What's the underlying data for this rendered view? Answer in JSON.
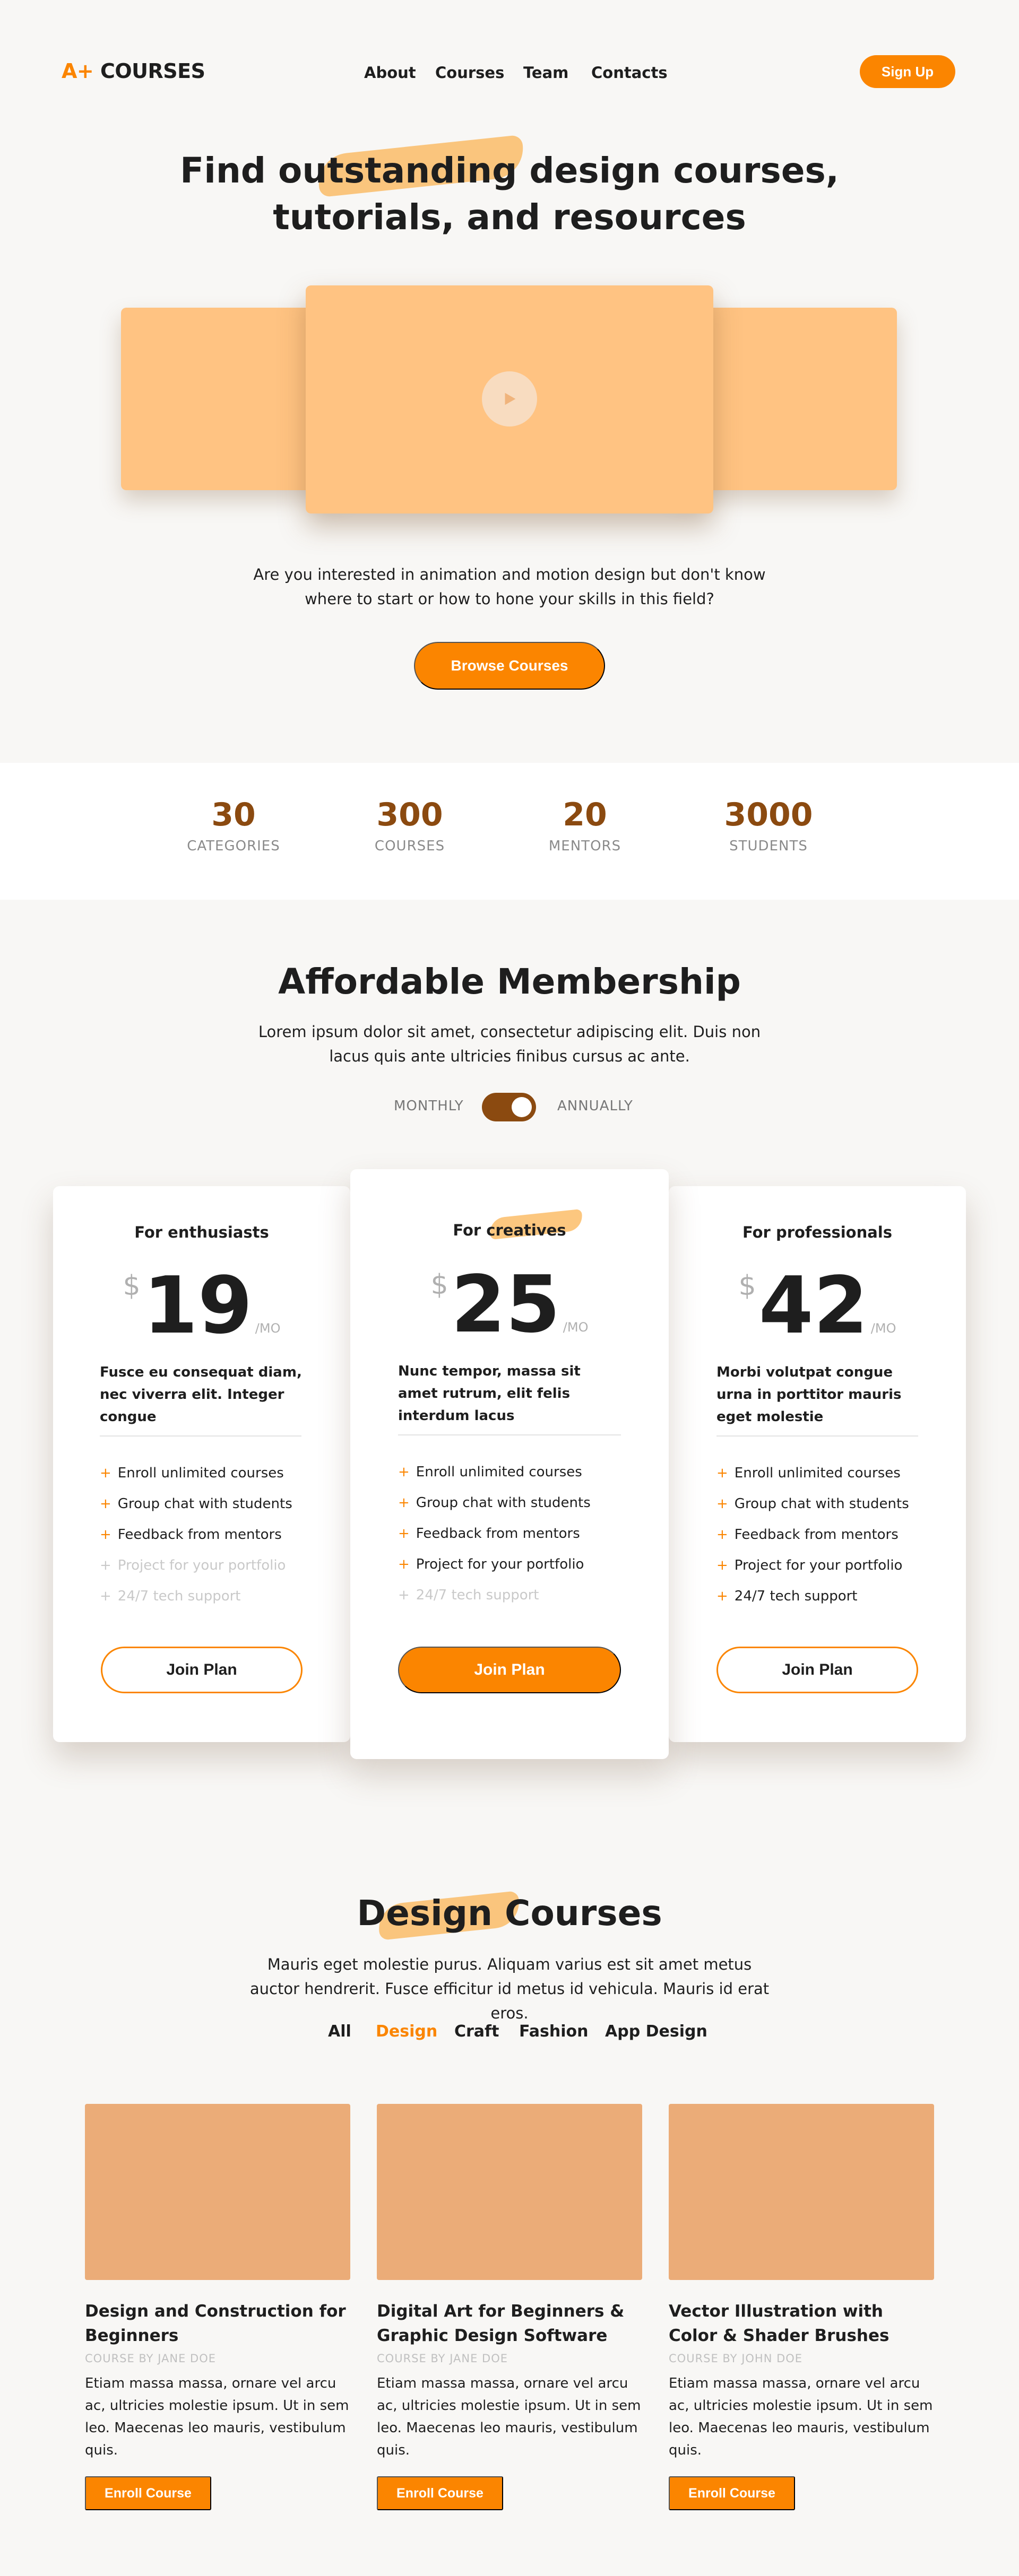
{
  "header": {
    "logo_prefix": "A+",
    "logo_text": "COURSES",
    "nav": [
      "About",
      "Courses",
      "Team",
      "Contacts"
    ],
    "signup_label": "Sign Up"
  },
  "hero": {
    "title_line1_a": "Find ",
    "title_line1_hl": "outstanding",
    "title_line1_b": " design courses,",
    "title_line2": "tutorials, and resources",
    "subtitle": "Are you interested in animation and motion design but don't know where to start or how to hone your skills in this field?",
    "browse_label": "Browse Courses",
    "play_icon": "play-icon"
  },
  "stats": [
    {
      "value": "30",
      "label": "CATEGORIES"
    },
    {
      "value": "300",
      "label": "COURSES"
    },
    {
      "value": "20",
      "label": "MENTORS"
    },
    {
      "value": "3000",
      "label": "STUDENTS"
    }
  ],
  "membership": {
    "title": "Affordable Membership",
    "subtitle": "Lorem ipsum dolor sit amet, consectetur adipiscing elit. Duis non lacus quis ante ultricies finibus cursus ac ante.",
    "toggle_left": "MONTHLY",
    "toggle_right": "ANNUALLY",
    "plans": [
      {
        "for_a": "For enthusiasts",
        "for_hl": "",
        "currency": "$",
        "price": "19",
        "per": "/MO",
        "description": "Fusce eu consequat diam, nec viverra elit. Integer congue",
        "features": [
          {
            "text": "Enroll unlimited courses",
            "enabled": true
          },
          {
            "text": "Group chat with students",
            "enabled": true
          },
          {
            "text": "Feedback from mentors",
            "enabled": true
          },
          {
            "text": "Project for your portfolio",
            "enabled": false
          },
          {
            "text": "24/7 tech support",
            "enabled": false
          }
        ],
        "button": "Join Plan"
      },
      {
        "for_a": "For ",
        "for_hl": "creatives",
        "currency": "$",
        "price": "25",
        "per": "/MO",
        "description": "Nunc tempor, massa sit amet rutrum, elit felis interdum lacus",
        "features": [
          {
            "text": "Enroll unlimited courses",
            "enabled": true
          },
          {
            "text": "Group chat with students",
            "enabled": true
          },
          {
            "text": "Feedback from mentors",
            "enabled": true
          },
          {
            "text": "Project for your portfolio",
            "enabled": true
          },
          {
            "text": "24/7 tech support",
            "enabled": false
          }
        ],
        "button": "Join Plan"
      },
      {
        "for_a": "For professionals",
        "for_hl": "",
        "currency": "$",
        "price": "42",
        "per": "/MO",
        "description": "Morbi volutpat congue urna in porttitor mauris eget molestie",
        "features": [
          {
            "text": "Enroll unlimited courses",
            "enabled": true
          },
          {
            "text": "Group chat with students",
            "enabled": true
          },
          {
            "text": "Feedback from mentors",
            "enabled": true
          },
          {
            "text": "Project for your portfolio",
            "enabled": true
          },
          {
            "text": "24/7 tech support",
            "enabled": true
          }
        ],
        "button": "Join Plan"
      }
    ]
  },
  "courses": {
    "title_hl": "Design",
    "title_rest": " Courses",
    "subtitle": "Mauris eget molestie purus. Aliquam varius est sit amet metus auctor hendrerit. Fusce efficitur id metus id vehicula. Mauris id erat eros.",
    "filters": [
      "All",
      "Design",
      "Craft",
      "Fashion",
      "App Design"
    ],
    "active_filter": "Design",
    "items": [
      {
        "title": "Design and Construction for Beginners",
        "author": "COURSE BY JANE DOE",
        "description": "Etiam massa massa, ornare vel arcu ac, ultricies molestie ipsum. Ut in sem leo. Maecenas leo mauris, vestibulum quis.",
        "button": "Enroll Course"
      },
      {
        "title": "Digital Art for Beginners & Graphic Design Software",
        "author": "COURSE BY JANE DOE",
        "description": "Etiam massa massa, ornare vel arcu ac, ultricies molestie ipsum. Ut in sem leo. Maecenas leo mauris, vestibulum quis.",
        "button": "Enroll Course"
      },
      {
        "title": "Vector Illustration with Color & Shader Brushes",
        "author": "COURSE BY JOHN DOE",
        "description": "Etiam massa massa, ornare vel arcu ac, ultricies molestie ipsum. Ut in sem leo. Maecenas leo mauris, vestibulum quis.",
        "button": "Enroll Course"
      }
    ]
  },
  "colors": {
    "accent": "#fb8500",
    "accent_dark": "#8b4a10",
    "video_placeholder": "#ffc382",
    "thumb_placeholder": "#ebac78",
    "background": "#f8f7f5"
  }
}
